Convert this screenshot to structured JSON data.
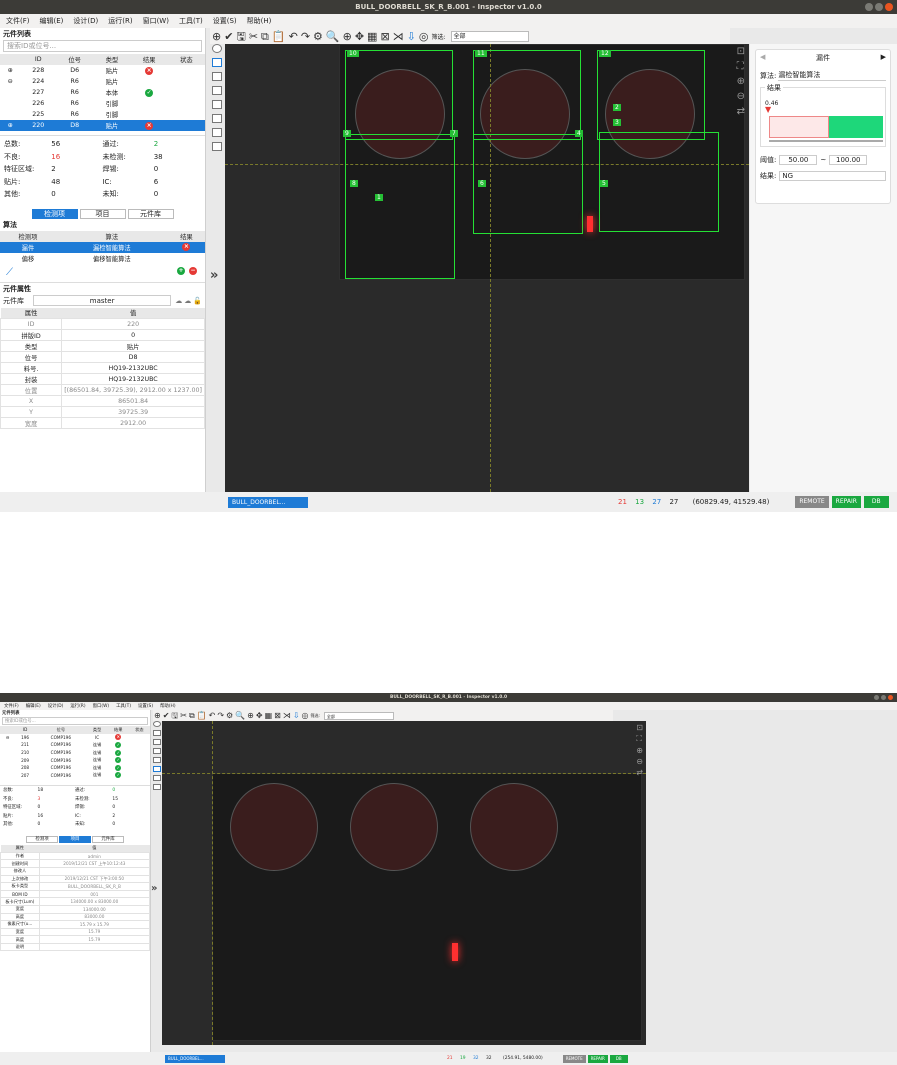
{
  "app": {
    "title": "BULL_DOORBELL_SK_R_B.001 - Inspector v1.0.0"
  },
  "menu": [
    "文件(F)",
    "编辑(E)",
    "设计(D)",
    "运行(R)",
    "窗口(W)",
    "工具(T)",
    "设置(S)",
    "帮助(H)"
  ],
  "toolbar": {
    "filter_label": "筛选:",
    "filter_value": "全部"
  },
  "screen1": {
    "list_title": "元件列表",
    "search_placeholder": "搜索ID或位号...",
    "columns": [
      "ID",
      "位号",
      "类型",
      "结果",
      "状态"
    ],
    "rows": [
      {
        "id": "228",
        "ref": "D6",
        "type": "贴片",
        "result": "fail"
      },
      {
        "id": "224",
        "ref": "R6",
        "type": "贴片",
        "result": ""
      },
      {
        "id": "227",
        "ref": "R6",
        "type": "本体",
        "result": "pass"
      },
      {
        "id": "226",
        "ref": "R6",
        "type": "引脚",
        "result": ""
      },
      {
        "id": "225",
        "ref": "R6",
        "type": "引脚",
        "result": ""
      },
      {
        "id": "220",
        "ref": "D8",
        "type": "贴片",
        "result": "fail"
      }
    ],
    "stats": [
      [
        "总数:",
        "56",
        "通过:",
        "2"
      ],
      [
        "不良:",
        "16",
        "未检测:",
        "38"
      ],
      [
        "特征区域:",
        "2",
        "焊锡:",
        "0"
      ],
      [
        "贴片:",
        "48",
        "IC:",
        "6"
      ],
      [
        "其他:",
        "0",
        "未知:",
        "0"
      ]
    ],
    "tabs": [
      "检测项",
      "项目",
      "元件库"
    ],
    "algo_title": "算法",
    "algo_columns": [
      "检测项",
      "算法",
      "结果"
    ],
    "algo_rows": [
      {
        "item": "漏件",
        "algo": "漏检智能算法",
        "result": "fail"
      },
      {
        "item": "偏移",
        "algo": "偏移智能算法",
        "result": ""
      }
    ],
    "props_title": "元件属性",
    "lib_label": "元件库",
    "lib_value": "master",
    "prop_columns": [
      "属性",
      "值"
    ],
    "props": [
      [
        "ID",
        "220"
      ],
      [
        "拼版ID",
        "0"
      ],
      [
        "类型",
        "贴片"
      ],
      [
        "位号",
        "D8"
      ],
      [
        "料号.",
        "HQ19-2132UBC"
      ],
      [
        "封装",
        "HQ19-2132UBC"
      ],
      [
        "位置",
        "[(86501.84, 39725.39), 2912.00 x 1237.00]"
      ],
      [
        "X",
        "86501.84"
      ],
      [
        "Y",
        "39725.39"
      ],
      [
        "宽度",
        "2912.00"
      ]
    ],
    "right": {
      "title": "漏件",
      "algo_label": "算法:",
      "algo_value": "漏检智能算法",
      "result_group": "结果",
      "marker_value": "0.46",
      "threshold_label": "阈值:",
      "threshold_min": "50.00",
      "threshold_sep": "~",
      "threshold_max": "100.00",
      "result_label": "结果:",
      "result_value": "NG"
    },
    "canvas_labels": [
      "10",
      "11",
      "12",
      "2",
      "3",
      "9",
      "7",
      "4",
      "8",
      "6",
      "5",
      "1"
    ],
    "status": {
      "tab": "BULL_DOORBEL...",
      "counts": [
        "21",
        "13",
        "27",
        "27"
      ],
      "coords": "(60829.49, 41529.48)",
      "buttons": [
        "REMOTE",
        "REPAIR",
        "DB"
      ]
    }
  },
  "screen2": {
    "list_title": "元件列表",
    "search_placeholder": "搜索ID或位号...",
    "columns": [
      "ID",
      "位号",
      "类型",
      "结果",
      "状态"
    ],
    "rows": [
      {
        "id": "196",
        "ref": "COMP196",
        "type": "IC",
        "result": "fail"
      },
      {
        "id": "211",
        "ref": "COMP196",
        "type": "连锡",
        "result": "pass"
      },
      {
        "id": "210",
        "ref": "COMP196",
        "type": "连锡",
        "result": "pass"
      },
      {
        "id": "209",
        "ref": "COMP196",
        "type": "连锡",
        "result": "pass"
      },
      {
        "id": "208",
        "ref": "COMP196",
        "type": "连锡",
        "result": "pass"
      },
      {
        "id": "207",
        "ref": "COMP196",
        "type": "连锡",
        "result": "pass"
      }
    ],
    "stats": [
      [
        "总数:",
        "18",
        "通过:",
        "0"
      ],
      [
        "不良:",
        "3",
        "未检测:",
        "15"
      ],
      [
        "特征区域:",
        "0",
        "焊锡:",
        "0"
      ],
      [
        "贴片:",
        "16",
        "IC:",
        "2"
      ],
      [
        "其他:",
        "0",
        "未知:",
        "0"
      ]
    ],
    "tabs": [
      "检测项",
      "项目",
      "元件库"
    ],
    "prop_columns": [
      "属性",
      "值"
    ],
    "props": [
      [
        "作者",
        "admin"
      ],
      [
        "创建时间",
        "2019/12/21 CST 上午10:12:43"
      ],
      [
        "修改人",
        ""
      ],
      [
        "上次修改",
        "2019/12/21 CST 下午3:00:50"
      ],
      [
        "板卡类型",
        "BULL_DOORBELL_SK_R_B"
      ],
      [
        "BOM ID",
        "001"
      ],
      [
        "板卡尺寸(Lum)",
        "134000.00 x 83000.00"
      ],
      [
        "宽度",
        "134000.00"
      ],
      [
        "高度",
        "83000.00"
      ],
      [
        "像素尺寸(u...",
        "15.79 x 15.79"
      ],
      [
        "宽度",
        "15.79"
      ],
      [
        "高度",
        "15.79"
      ],
      [
        "说明",
        ""
      ]
    ],
    "status": {
      "tab": "BULL_DOORBEL...",
      "counts": [
        "21",
        "19",
        "32",
        "32"
      ],
      "coords": "(254.91, 5480.00)",
      "buttons": [
        "REMOTE",
        "REPAIR",
        "DB"
      ]
    }
  }
}
